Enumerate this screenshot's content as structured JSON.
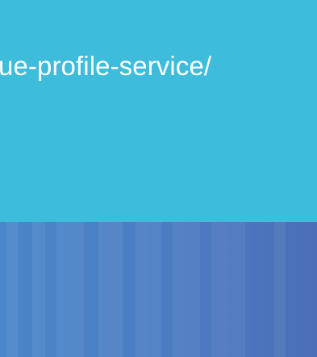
{
  "banner": {
    "url_fragment": "ue-profile-service/",
    "background_color": "#3ebcdc",
    "text_color": "#ffffff"
  },
  "lower_panel": {
    "gradient_colors": [
      "#4a86c8",
      "#4b6fb7"
    ]
  }
}
